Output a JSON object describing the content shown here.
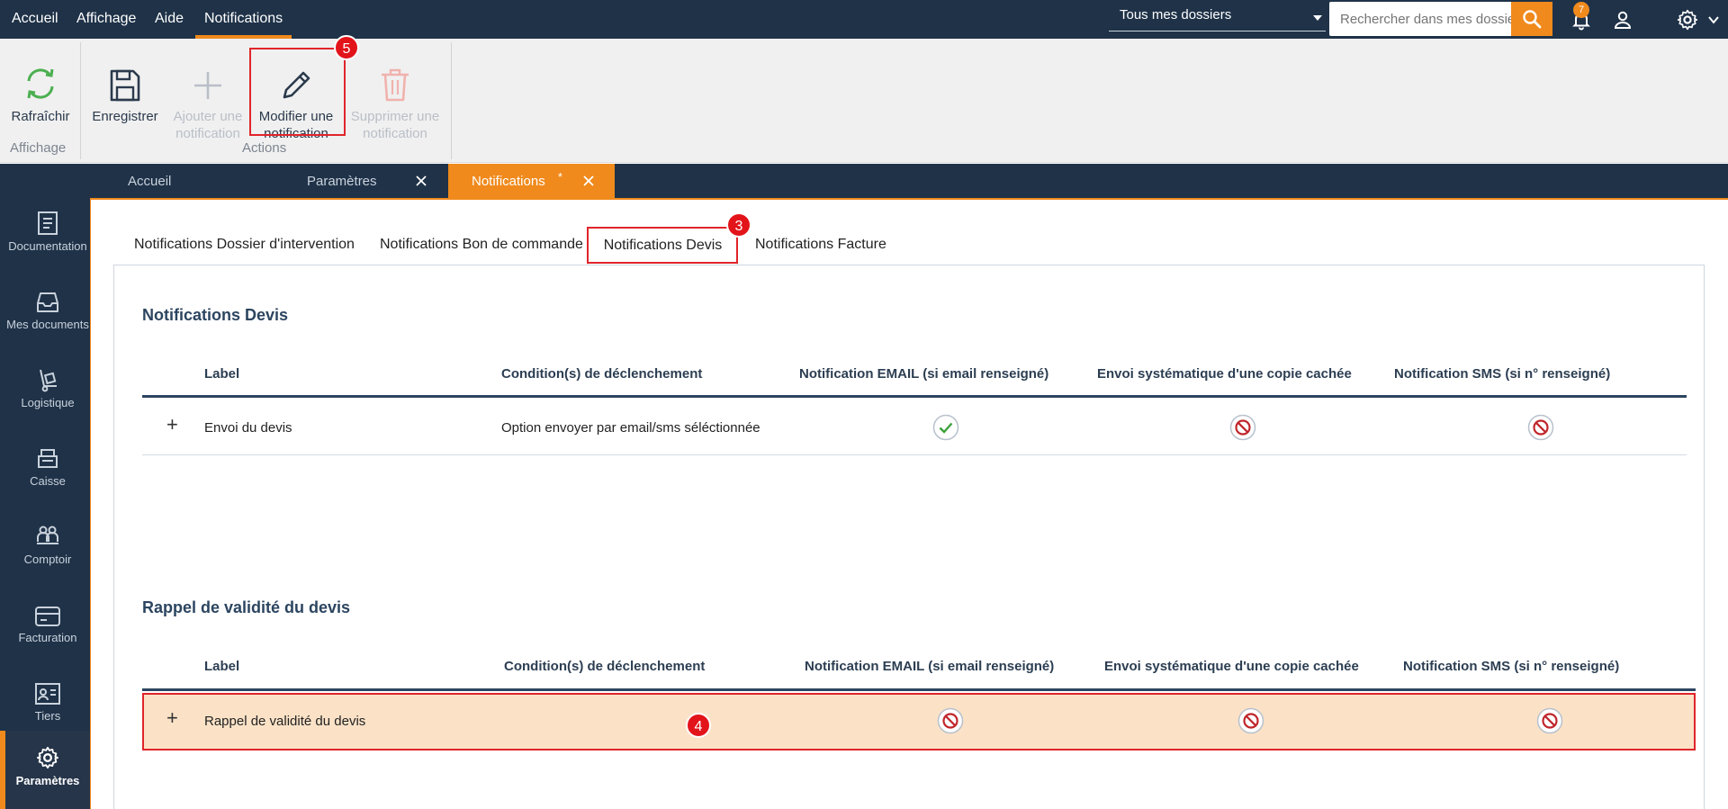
{
  "top_menu": {
    "items": [
      "Accueil",
      "Affichage",
      "Aide",
      "Notifications"
    ],
    "active": "Notifications"
  },
  "header": {
    "dossier_select": "Tous mes dossiers",
    "search_placeholder": "Rechercher dans mes dossiers",
    "notification_count": "7"
  },
  "ribbon": {
    "refresh_label": "Rafraîchir",
    "save_label": "Enregistrer",
    "add_label": "Ajouter une notification",
    "edit_label": "Modifier une notification",
    "delete_label": "Supprimer une notification",
    "group_display": "Affichage",
    "group_actions": "Actions"
  },
  "doc_tabs": {
    "home": "Accueil",
    "settings": "Paramètres",
    "notifications": "Notifications",
    "modified_marker": "*"
  },
  "sidebar": {
    "items": [
      "Documentation",
      "Mes documents",
      "Logistique",
      "Caisse",
      "Comptoir",
      "Facturation",
      "Tiers",
      "Paramètres"
    ]
  },
  "sub_tabs": [
    "Notifications Dossier d'intervention",
    "Notifications Bon de commande",
    "Notifications Devis",
    "Notifications Facture"
  ],
  "annotations": {
    "step_5": "5",
    "step_3": "3",
    "step_4": "4"
  },
  "sections": [
    {
      "title": "Notifications Devis",
      "headers": [
        "Label",
        "Condition(s) de déclenchement",
        "Notification EMAIL (si email renseigné)",
        "Envoi systématique d'une copie cachée",
        "Notification SMS (si n° renseigné)"
      ],
      "rows": [
        {
          "expand": "+",
          "label": "Envoi du devis",
          "condition": "Option envoyer par email/sms séléctionnée",
          "email": "enabled",
          "bcc": "disabled",
          "sms": "disabled"
        }
      ]
    },
    {
      "title": "Rappel de validité du devis",
      "headers": [
        "Label",
        "Condition(s) de déclenchement",
        "Notification EMAIL (si email renseigné)",
        "Envoi systématique d'une copie cachée",
        "Notification SMS (si n° renseigné)"
      ],
      "rows": [
        {
          "expand": "+",
          "label": "Rappel de validité du devis",
          "condition": "",
          "email": "disabled",
          "bcc": "disabled",
          "sms": "disabled"
        }
      ]
    }
  ],
  "colors": {
    "navy": "#1f3248",
    "accent": "#f08a1c",
    "highlight_red": "#e0252b",
    "enabled_green": "#3aa23a",
    "disabled_red": "#c0262b",
    "selected_row": "#fbe2c7"
  }
}
